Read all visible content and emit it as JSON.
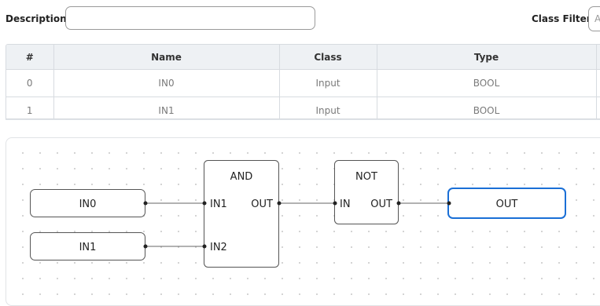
{
  "filters": {
    "description_label": "Description :",
    "description_value": "",
    "class_filter_label": "Class Filter :",
    "class_filter_value": "A"
  },
  "table": {
    "headers": [
      "#",
      "Name",
      "Class",
      "Type"
    ],
    "rows": [
      {
        "index": "0",
        "name": "IN0",
        "class": "Input",
        "type": "BOOL"
      },
      {
        "index": "1",
        "name": "IN1",
        "class": "Input",
        "type": "BOOL"
      }
    ]
  },
  "diagram": {
    "inputs": [
      {
        "label": "IN0"
      },
      {
        "label": "IN1"
      }
    ],
    "and_block": {
      "title": "AND",
      "in1": "IN1",
      "in2": "IN2",
      "out": "OUT"
    },
    "not_block": {
      "title": "NOT",
      "in": "IN",
      "out": "OUT"
    },
    "output": {
      "label": "OUT",
      "selected": true
    },
    "colors": {
      "selected_border": "#1a6fd6",
      "node_border": "#555555",
      "wire": "#555555"
    }
  }
}
